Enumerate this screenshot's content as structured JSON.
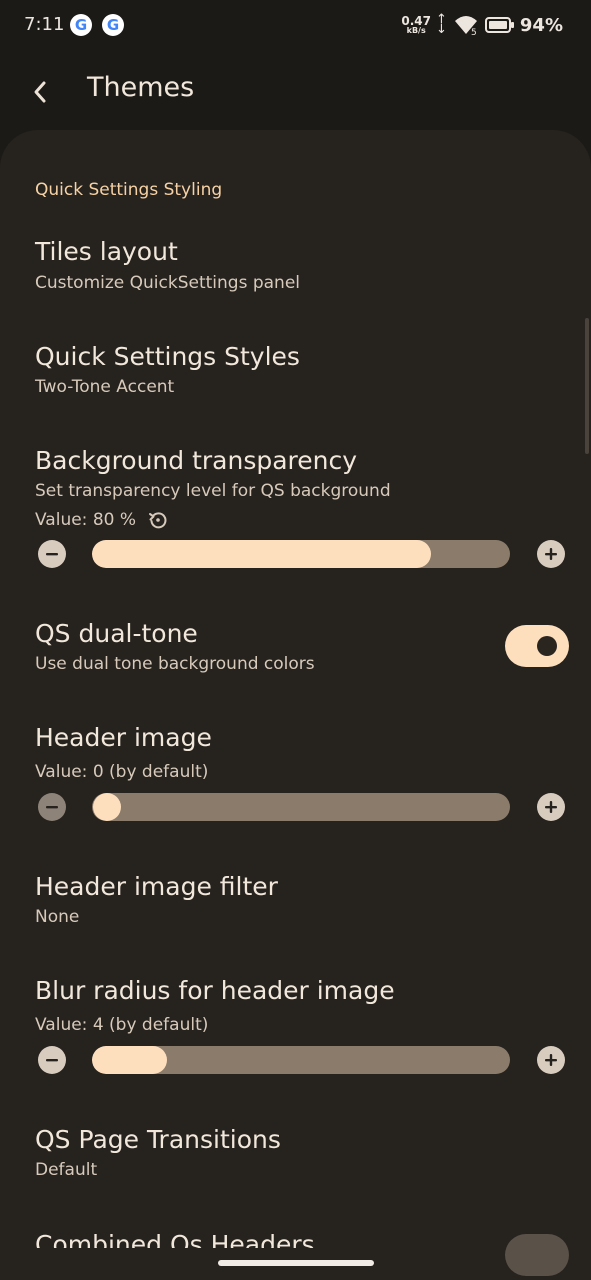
{
  "status_bar": {
    "time": "7:11",
    "notification_icons": [
      "google-g-icon",
      "google-g-icon"
    ],
    "net_speed_value": "0.47",
    "net_speed_unit": "kB/s",
    "wifi_badge": "5",
    "battery_percent": "94%"
  },
  "app_bar": {
    "title": "Themes"
  },
  "section": {
    "header": "Quick Settings Styling"
  },
  "prefs": {
    "tiles_layout": {
      "title": "Tiles layout",
      "summary": "Customize QuickSettings panel"
    },
    "qs_styles": {
      "title": "Quick Settings Styles",
      "summary": "Two-Tone Accent"
    },
    "bg_transparency": {
      "title": "Background transparency",
      "summary": "Set transparency level for QS background",
      "value_text": "Value: 80 %",
      "value": 80,
      "fill_fraction": 0.81
    },
    "qs_dual_tone": {
      "title": "QS dual-tone",
      "summary": "Use dual tone background colors",
      "enabled": true
    },
    "header_image": {
      "title": "Header image",
      "value_text": "Value: 0 (by default)",
      "value": 0
    },
    "header_image_filter": {
      "title": "Header image filter",
      "summary": "None"
    },
    "blur_radius": {
      "title": "Blur radius for header image",
      "value_text": "Value: 4 (by default)",
      "value": 4,
      "fill_fraction": 0.18
    },
    "qs_page_transitions": {
      "title": "QS Page Transitions",
      "summary": "Default"
    },
    "combined_qs_headers": {
      "title": "Combined Qs Headers"
    }
  },
  "colors": {
    "background": "#1c1a17",
    "panel": "#26221e",
    "accent": "#fddfbe",
    "section_header": "#f6d2a5",
    "track": "#8a7b6a"
  }
}
